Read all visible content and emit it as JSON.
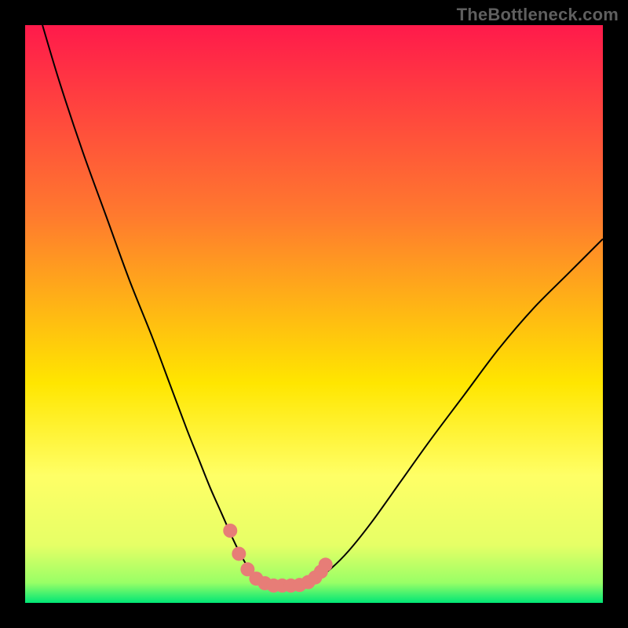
{
  "watermark": "TheBottleneck.com",
  "chart_data": {
    "type": "line",
    "title": "",
    "xlabel": "",
    "ylabel": "",
    "xlim": [
      0,
      100
    ],
    "ylim": [
      0,
      100
    ],
    "grid": false,
    "legend": false,
    "background_gradient": {
      "stops": [
        {
          "offset": 0.0,
          "color": "#ff1a4b"
        },
        {
          "offset": 0.33,
          "color": "#ff7a2e"
        },
        {
          "offset": 0.62,
          "color": "#ffe600"
        },
        {
          "offset": 0.78,
          "color": "#ffff66"
        },
        {
          "offset": 0.9,
          "color": "#e6ff66"
        },
        {
          "offset": 0.965,
          "color": "#99ff66"
        },
        {
          "offset": 1.0,
          "color": "#00e676"
        }
      ]
    },
    "series": [
      {
        "name": "curve",
        "color": "#000000",
        "stroke_width": 2,
        "x": [
          3,
          6,
          10,
          14,
          18,
          22,
          25,
          28,
          30,
          32,
          34,
          36,
          37.5,
          39,
          40.5,
          42,
          44,
          46,
          48,
          50.5,
          53,
          56,
          60,
          65,
          70,
          76,
          82,
          88,
          94,
          100
        ],
        "y": [
          100,
          90,
          78,
          67,
          56,
          46,
          38,
          30,
          25,
          20,
          15.5,
          11,
          8,
          5.5,
          4,
          3.3,
          3,
          3,
          3.2,
          4.2,
          6,
          9,
          14,
          21,
          28,
          36,
          44,
          51,
          57,
          63
        ]
      },
      {
        "name": "highlight-band",
        "type": "scatter",
        "color": "#e77d77",
        "marker_radius": 9,
        "x": [
          35.5,
          37,
          38.5,
          40,
          41.5,
          43,
          44.5,
          46,
          47.5,
          49,
          50.2,
          51.2,
          52
        ],
        "y": [
          12.5,
          8.5,
          5.8,
          4.2,
          3.4,
          3,
          3,
          3,
          3.1,
          3.6,
          4.4,
          5.4,
          6.6
        ]
      }
    ]
  }
}
